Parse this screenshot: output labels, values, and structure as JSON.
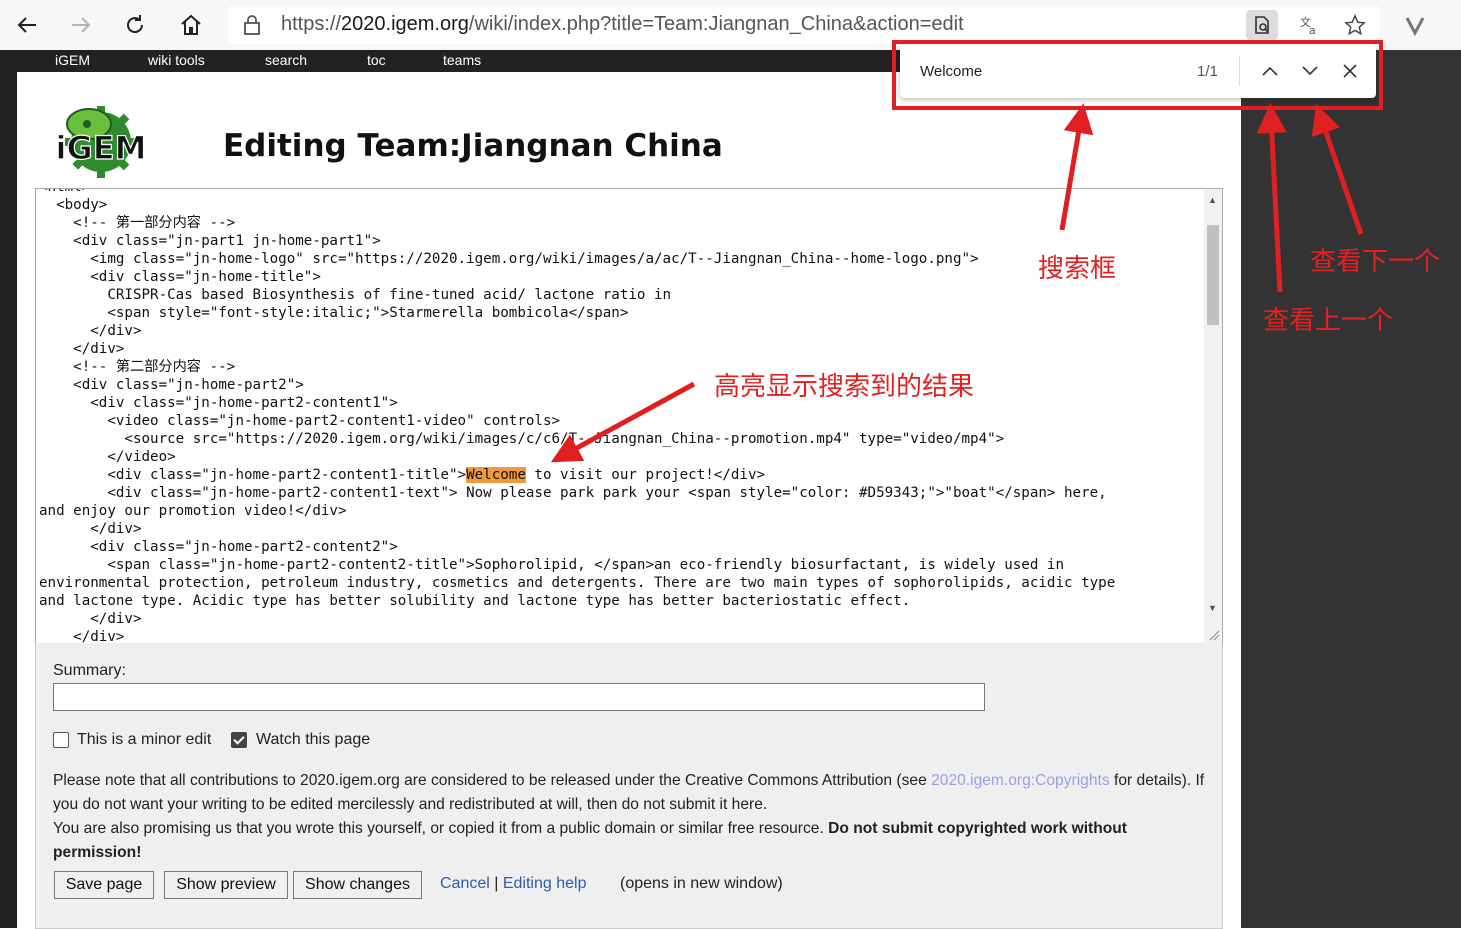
{
  "browser": {
    "url_prefix": "https://",
    "url_domain": "2020.igem.org",
    "url_rest": "/wiki/index.php?title=Team:Jiangnan_China&action=edit"
  },
  "menu": [
    "iGEM",
    "wiki tools",
    "search",
    "toc",
    "teams"
  ],
  "page": {
    "logo_text": "iGEM",
    "title": "Editing Team:Jiangnan China"
  },
  "editor": {
    "lines": [
      "<html>",
      "  <body>",
      "    <!-- 第一部分内容 -->",
      "    <div class=\"jn-part1 jn-home-part1\">",
      "      <img class=\"jn-home-logo\" src=\"https://2020.igem.org/wiki/images/a/ac/T--Jiangnan_China--home-logo.png\">",
      "      <div class=\"jn-home-title\">",
      "        CRISPR-Cas based Biosynthesis of fine-tuned acid/ lactone ratio in",
      "        <span style=\"font-style:italic;\">Starmerella bombicola</span>",
      "      </div>",
      "    </div>",
      "    <!-- 第二部分内容 -->",
      "    <div class=\"jn-home-part2\">",
      "      <div class=\"jn-home-part2-content1\">",
      "        <video class=\"jn-home-part2-content1-video\" controls>",
      "          <source src=\"https://2020.igem.org/wiki/images/c/c6/T--Jiangnan_China--promotion.mp4\" type=\"video/mp4\">",
      "        </video>"
    ],
    "hl_prefix": "        <div class=\"jn-home-part2-content1-title\">",
    "hl_word": "Welcome",
    "hl_suffix": " to visit our project!</div>",
    "lines2": [
      "        <div class=\"jn-home-part2-content1-text\"> Now please park park your <span style=\"color: #D59343;\">\"boat\"</span> here,",
      "and enjoy our promotion video!</div>",
      "      </div>",
      "      <div class=\"jn-home-part2-content2\">",
      "        <span class=\"jn-home-part2-content2-title\">Sophorolipid, </span>an eco-friendly biosurfactant, is widely used in",
      "environmental protection, petroleum industry, cosmetics and detergents. There are two main types of sophorolipids, acidic type",
      "and lactone type. Acidic type has better solubility and lactone type has better bacteriostatic effect.",
      "      </div>",
      "    </div>"
    ]
  },
  "form": {
    "summary_label": "Summary:",
    "minor_edit_label": "This is a minor edit",
    "minor_edit_checked": false,
    "watch_label": "Watch this page",
    "watch_checked": true,
    "notice_1": "Please note that all contributions to 2020.igem.org are considered to be released under the Creative Commons Attribution (see ",
    "notice_link": "2020.igem.org:Copyrights",
    "notice_2": " for details). If you do not want your writing to be edited mercilessly and redistributed at will, then do not submit it here.",
    "notice_3": "You are also promising us that you wrote this yourself, or copied it from a public domain or similar free resource. ",
    "notice_bold": "Do not submit copyrighted work without permission!",
    "save_button": "Save page",
    "preview_button": "Show preview",
    "changes_button": "Show changes",
    "cancel_link": "Cancel",
    "separator": " | ",
    "help_link": "Editing help",
    "help_note": "(opens in new window)"
  },
  "find": {
    "query": "Welcome",
    "count": "1/1"
  },
  "annotations": {
    "search_box": "搜索框",
    "next": "查看下一个",
    "prev": "查看上一个",
    "highlight": "高亮显示搜索到的结果"
  },
  "colors": {
    "highlight": "#f09a3c",
    "annotation": "#e02020",
    "link": "#2a5db0"
  }
}
